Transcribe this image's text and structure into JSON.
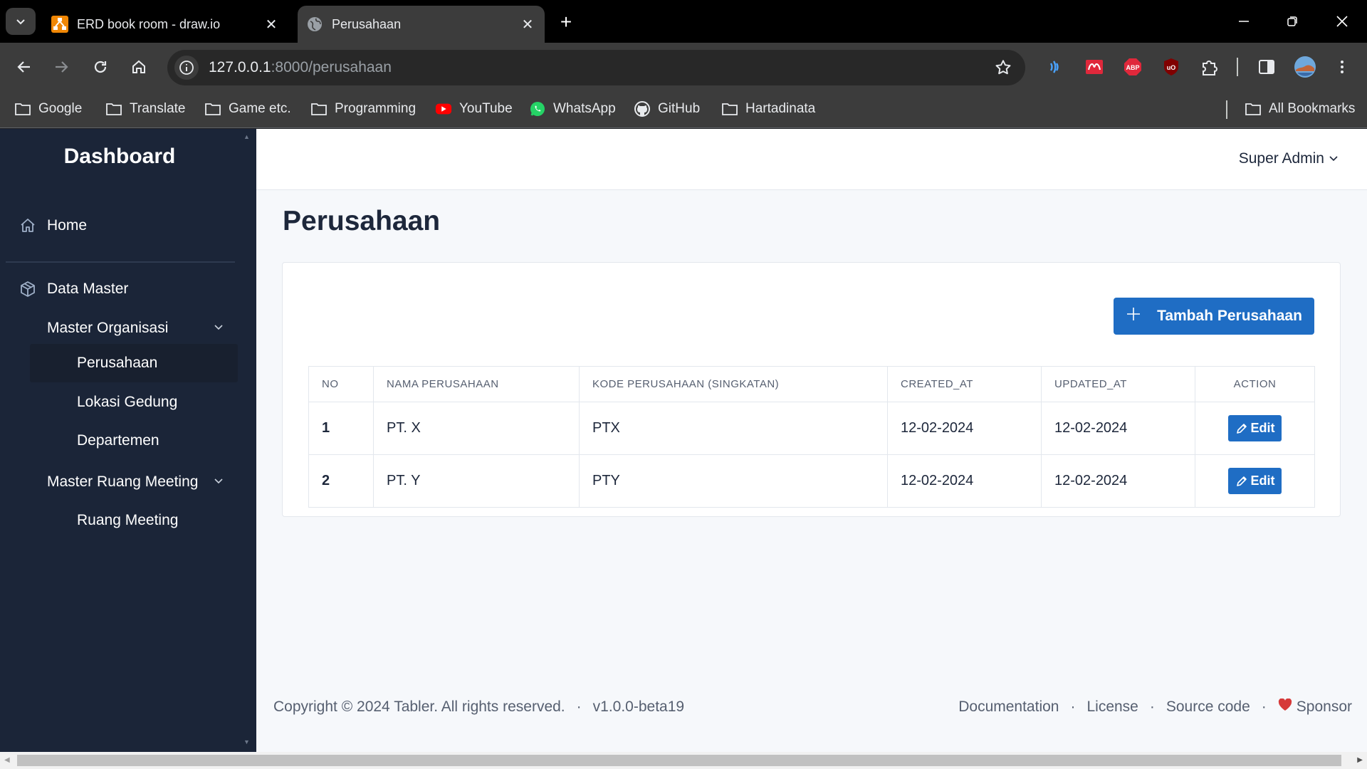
{
  "browser": {
    "tabs": [
      {
        "title": "ERD book room - draw.io",
        "active": false,
        "favicon": "drawio-icon"
      },
      {
        "title": "Perusahaan",
        "active": true,
        "favicon": "globe-icon"
      }
    ],
    "address": {
      "host": "127.0.0.1",
      "path": ":8000/perusahaan"
    },
    "bookmarks": [
      {
        "label": "Google",
        "icon": "folder-icon"
      },
      {
        "label": "Translate",
        "icon": "folder-icon"
      },
      {
        "label": "Game etc.",
        "icon": "folder-icon"
      },
      {
        "label": "Programming",
        "icon": "folder-icon"
      },
      {
        "label": "YouTube",
        "icon": "youtube-icon"
      },
      {
        "label": "WhatsApp",
        "icon": "whatsapp-icon"
      },
      {
        "label": "GitHub",
        "icon": "github-icon"
      },
      {
        "label": "Hartadinata",
        "icon": "folder-icon"
      }
    ],
    "all_bookmarks": "All Bookmarks",
    "extensions": {
      "abp_label": "ABP",
      "ublock_label": "uO"
    }
  },
  "sidebar": {
    "brand": "Dashboard",
    "home": "Home",
    "data_master": "Data Master",
    "master_organisasi": "Master Organisasi",
    "perusahaan": "Perusahaan",
    "lokasi_gedung": "Lokasi Gedung",
    "departemen": "Departemen",
    "master_ruang_meeting": "Master Ruang Meeting",
    "ruang_meeting": "Ruang Meeting"
  },
  "header": {
    "user": "Super Admin"
  },
  "main": {
    "title": "Perusahaan",
    "add_button": "Tambah Perusahaan",
    "table": {
      "columns": [
        "NO",
        "NAMA PERUSAHAAN",
        "KODE PERUSAHAAN (SINGKATAN)",
        "CREATED_AT",
        "UPDATED_AT",
        "ACTION"
      ],
      "rows": [
        {
          "no": "1",
          "nama": "PT. X",
          "kode": "PTX",
          "created_at": "12-02-2024",
          "updated_at": "12-02-2024",
          "action": "Edit"
        },
        {
          "no": "2",
          "nama": "PT. Y",
          "kode": "PTY",
          "created_at": "12-02-2024",
          "updated_at": "12-02-2024",
          "action": "Edit"
        }
      ]
    }
  },
  "footer": {
    "copyright": "Copyright © 2024 Tabler. All rights reserved.",
    "version": "v1.0.0-beta19",
    "links": [
      "Documentation",
      "License",
      "Source code",
      "Sponsor"
    ],
    "separator": "·"
  },
  "colors": {
    "primary": "#1f6dc4",
    "sidebar_bg": "#1b2538",
    "page_bg": "#f6f8fb",
    "heart": "#d63939"
  }
}
